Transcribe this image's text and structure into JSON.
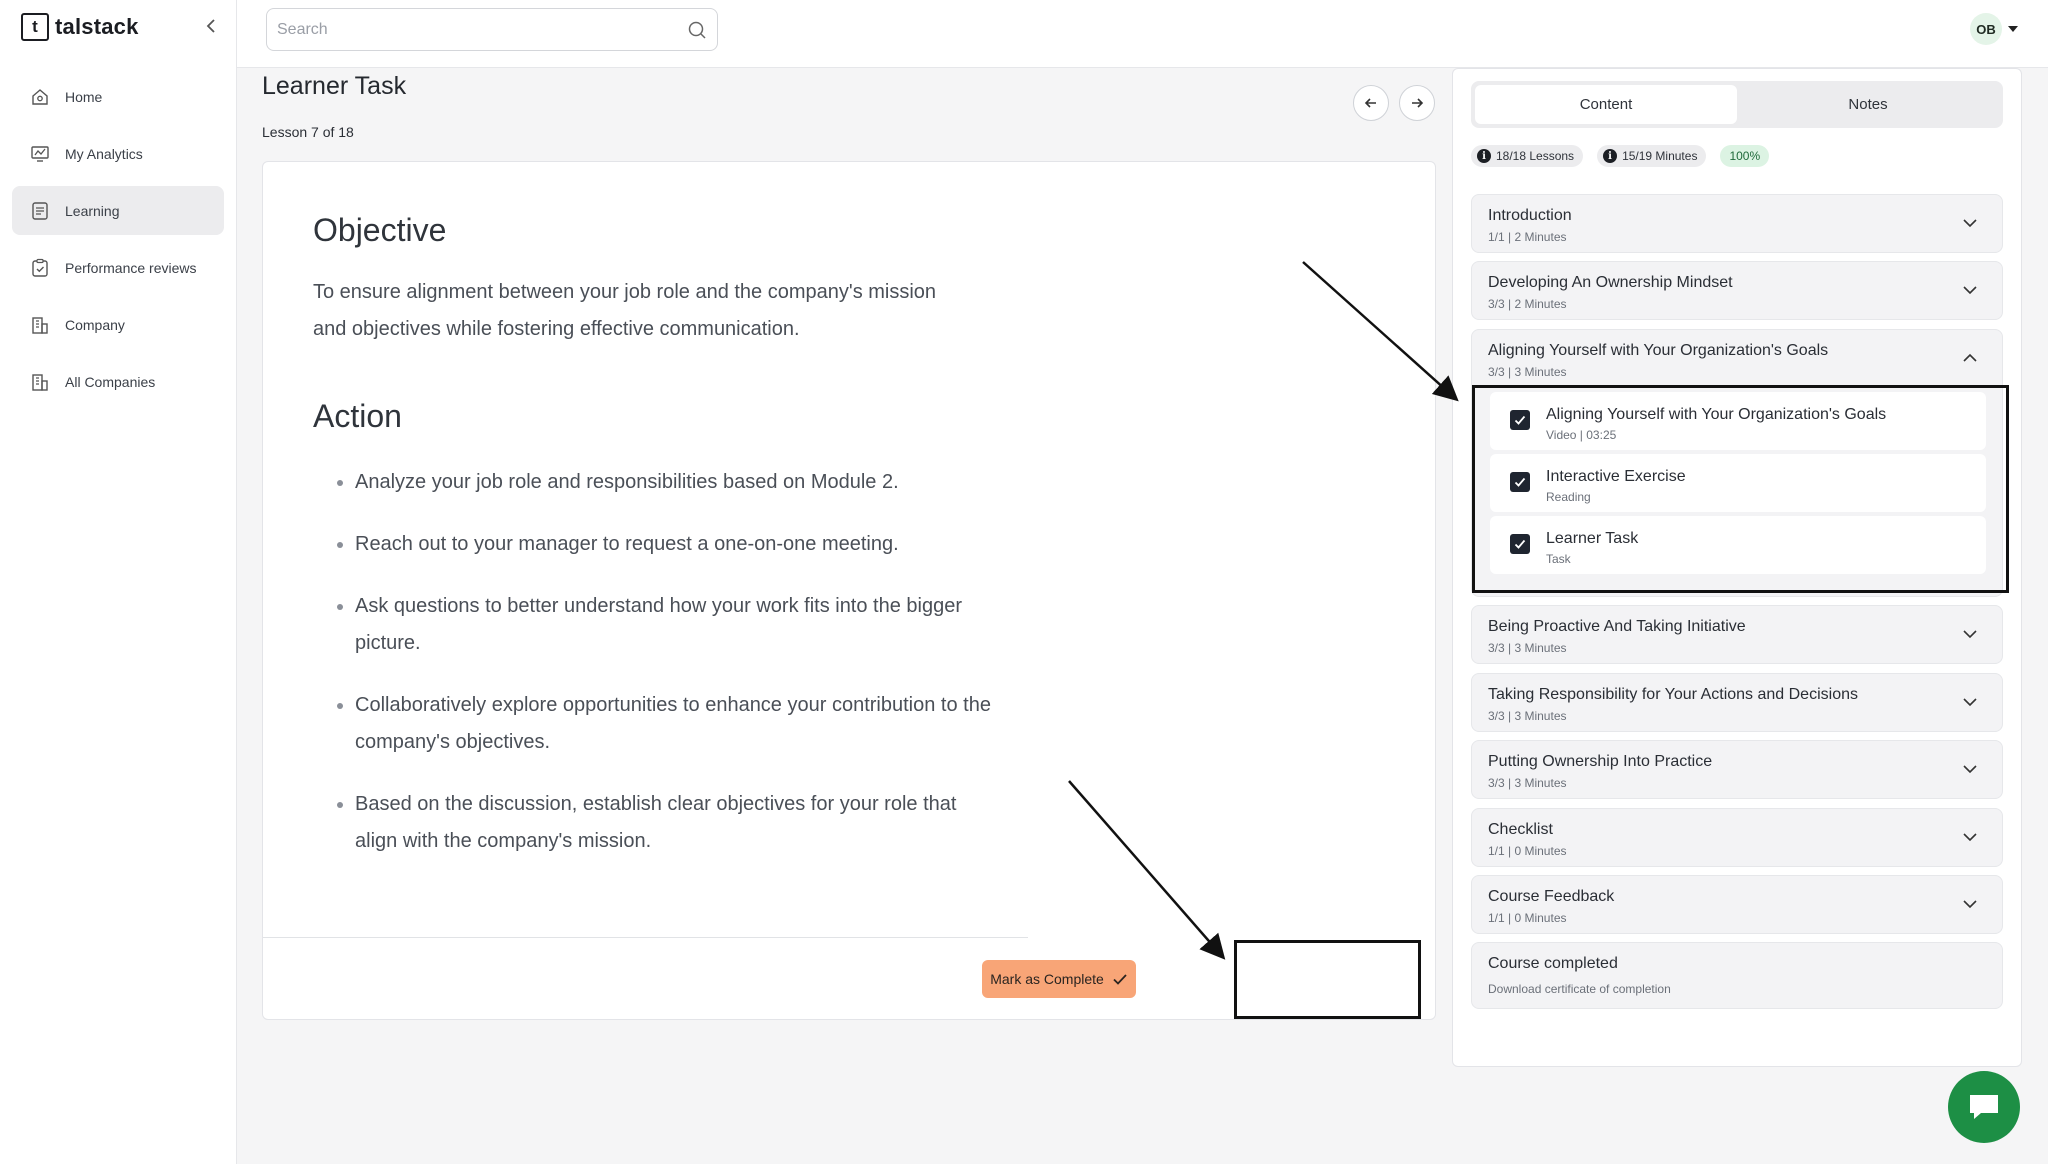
{
  "app": {
    "logo_letter": "t",
    "logo_text": "talstack"
  },
  "sidebar": {
    "items": [
      {
        "label": "Home",
        "icon": "home-icon",
        "active": false
      },
      {
        "label": "My Analytics",
        "icon": "analytics-icon",
        "active": false
      },
      {
        "label": "Learning",
        "icon": "learning-icon",
        "active": true
      },
      {
        "label": "Performance reviews",
        "icon": "clipboard-check-icon",
        "active": false
      },
      {
        "label": "Company",
        "icon": "building-icon",
        "active": false
      },
      {
        "label": "All Companies",
        "icon": "buildings-icon",
        "active": false
      }
    ]
  },
  "topbar": {
    "search_placeholder": "Search",
    "avatar_initials": "OB"
  },
  "page": {
    "title": "Learner Task",
    "lesson_count": "Lesson 7 of 18"
  },
  "content": {
    "objective_heading": "Objective",
    "objective_text": "To ensure alignment between your job role and the company's mission and objectives while fostering effective communication.",
    "action_heading": "Action",
    "action_items": [
      "Analyze your job role and responsibilities based on Module 2.",
      "Reach out to your manager to request a one-on-one meeting.",
      "Ask questions to better understand how your work fits into the bigger picture.",
      "Collaboratively explore opportunities to enhance your contribution to the company's objectives.",
      "Based on the discussion, establish clear objectives for your role that align with the company's mission."
    ],
    "complete_button": "Mark as Complete"
  },
  "panel": {
    "tabs": [
      "Content",
      "Notes"
    ],
    "active_tab": "Content",
    "badges": {
      "lessons": "18/18 Lessons",
      "minutes": "15/19 Minutes",
      "percent": "100%"
    },
    "sections": [
      {
        "title": "Introduction",
        "subtitle": "1/1 | 2 Minutes"
      },
      {
        "title": "Developing An Ownership Mindset",
        "subtitle": "3/3 | 2 Minutes"
      },
      {
        "title": "Aligning Yourself with Your Organization's Goals",
        "subtitle": "3/3 | 3 Minutes",
        "expanded": true,
        "lessons": [
          {
            "title": "Aligning Yourself with Your Organization's Goals",
            "subtitle": "Video | 03:25",
            "checked": true
          },
          {
            "title": "Interactive Exercise",
            "subtitle": "Reading",
            "checked": true
          },
          {
            "title": "Learner Task",
            "subtitle": "Task",
            "checked": true
          }
        ]
      },
      {
        "title": "Being Proactive And Taking Initiative",
        "subtitle": "3/3 | 3 Minutes"
      },
      {
        "title": "Taking Responsibility for Your Actions and Decisions",
        "subtitle": "3/3 | 3 Minutes"
      },
      {
        "title": "Putting Ownership Into Practice",
        "subtitle": "3/3 | 3 Minutes"
      },
      {
        "title": "Checklist",
        "subtitle": "1/1 | 0 Minutes"
      },
      {
        "title": "Course Feedback",
        "subtitle": "1/1 | 0 Minutes"
      },
      {
        "title": "Course completed",
        "subtitle": "Download certificate of completion"
      }
    ]
  },
  "colors": {
    "accent_button": "#f8a577",
    "chat_fab": "#1d8f45",
    "progress_green_bg": "#dcf3e3"
  }
}
